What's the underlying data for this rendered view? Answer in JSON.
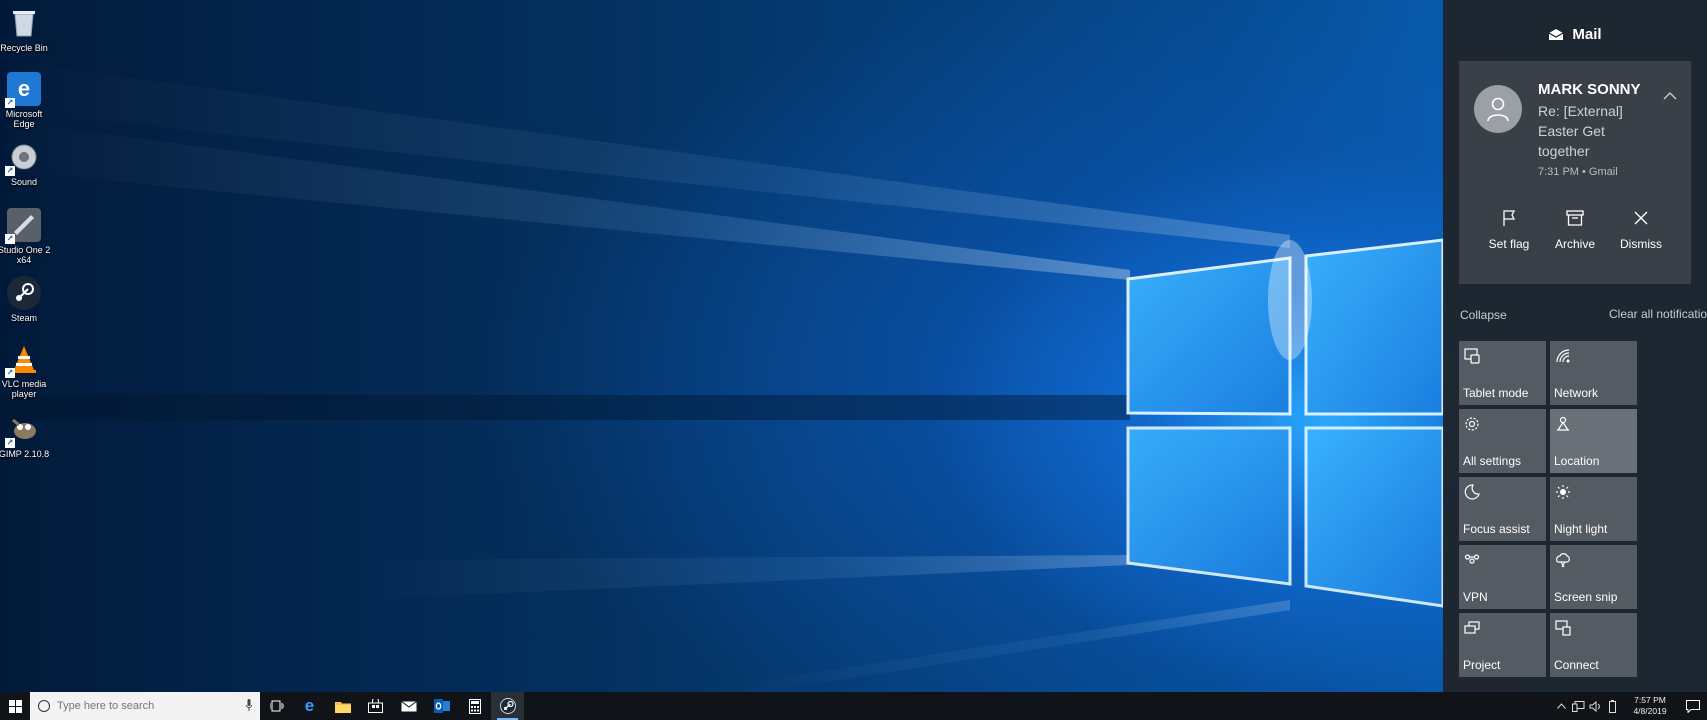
{
  "desktop": {
    "icons": [
      {
        "label": "Recycle Bin",
        "icon": "recycle-bin-icon"
      },
      {
        "label": "Microsoft Edge",
        "icon": "edge-icon"
      },
      {
        "label": "Sound",
        "icon": "speaker-icon"
      },
      {
        "label": "Studio One 2 x64",
        "icon": "studio-one-icon"
      },
      {
        "label": "Steam",
        "icon": "steam-icon"
      },
      {
        "label": "VLC media player",
        "icon": "vlc-cone-icon"
      },
      {
        "label": "GIMP 2.10.8",
        "icon": "gimp-icon"
      }
    ]
  },
  "action_center": {
    "title": "Mail",
    "notification": {
      "sender": "MARK SONNY",
      "subject": "Re: [External] Easter Get together",
      "meta": "7:31 PM • Gmail",
      "actions": [
        "Set flag",
        "Archive",
        "Dismiss"
      ]
    },
    "collapse_label": "Collapse",
    "clear_all_label": "Clear all notifications",
    "quick_actions": [
      {
        "label": "Tablet mode",
        "icon": "tablet-mode-icon",
        "state": "off"
      },
      {
        "label": "Network",
        "icon": "network-icon",
        "state": "off"
      },
      {
        "label": "All settings",
        "icon": "gear-icon",
        "state": "off"
      },
      {
        "label": "Location",
        "icon": "location-icon",
        "state": "on"
      },
      {
        "label": "Focus assist",
        "icon": "moon-icon",
        "state": "off"
      },
      {
        "label": "Night light",
        "icon": "sun-icon",
        "state": "off"
      },
      {
        "label": "VPN",
        "icon": "vpn-icon",
        "state": "off"
      },
      {
        "label": "Screen snip",
        "icon": "screen-snip-icon",
        "state": "off"
      },
      {
        "label": "Project",
        "icon": "project-icon",
        "state": "off"
      },
      {
        "label": "Connect",
        "icon": "connect-icon",
        "state": "off"
      }
    ]
  },
  "taskbar": {
    "search_placeholder": "Type here to search",
    "apps": [
      "task-view",
      "edge",
      "file-explorer",
      "store",
      "mail",
      "outlook",
      "calculator",
      "steam"
    ],
    "active_app": "steam",
    "clock": {
      "time": "7:57 PM",
      "date": "4/8/2019"
    },
    "accent": "#7ab8ff"
  }
}
